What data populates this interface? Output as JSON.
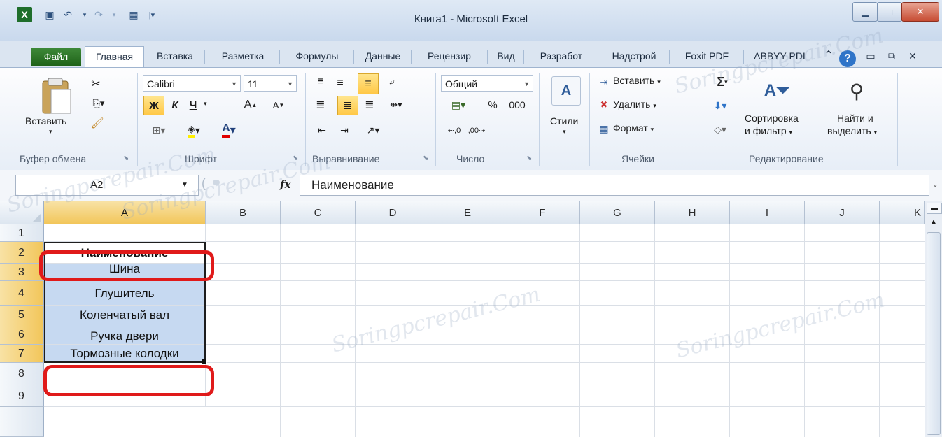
{
  "window": {
    "title": "Книга1  -  Microsoft Excel",
    "controls": [
      "minimize-icon",
      "maximize-icon",
      "close-icon"
    ]
  },
  "tabs": [
    "Файл",
    "Главная",
    "Вставка",
    "Разметка",
    "Формулы",
    "Данные",
    "Рецензир",
    "Вид",
    "Разработ",
    "Надстрой",
    "Foxit PDF",
    "ABBYY PDI"
  ],
  "ribbon": {
    "clipboard": {
      "paste": "Вставить",
      "label": "Буфер обмена"
    },
    "font": {
      "name": "Calibri",
      "size": "11",
      "label": "Шрифт",
      "bold": "Ж",
      "italic": "К",
      "underline": "Ч"
    },
    "alignment": {
      "label": "Выравнивание"
    },
    "number": {
      "format": "Общий",
      "percent": "%",
      "thousands": "000",
      "label": "Число"
    },
    "styles": {
      "label": "Стили"
    },
    "cells": {
      "insert": "Вставить",
      "delete": "Удалить",
      "format": "Формат",
      "label": "Ячейки"
    },
    "editing": {
      "sort_line1": "Сортировка",
      "sort_line2": "и фильтр",
      "find_line1": "Найти и",
      "find_line2": "выделить",
      "label": "Редактирование",
      "sum": "Σ"
    }
  },
  "formula_bar": {
    "name_box": "A2",
    "fx": "fx",
    "value": "Наименование"
  },
  "columns": [
    "A",
    "B",
    "C",
    "D",
    "E",
    "F",
    "G",
    "H",
    "I",
    "J",
    "K"
  ],
  "rows": [
    "1",
    "2",
    "3",
    "4",
    "5",
    "6",
    "7",
    "8",
    "9"
  ],
  "cells": {
    "A2": "Наименование",
    "A3": "Шина",
    "A4": "Глушитель",
    "A5": "Коленчатый вал",
    "A6": "Ручка двери",
    "A7": "Тормозные колодки"
  },
  "colors": {
    "selection": "#c6d9f1",
    "header_selected": "#f2c65a",
    "annotation_ring": "#e01a1a",
    "file_tab": "#2e7a28"
  },
  "watermark": "Soringpcrepair.Com"
}
